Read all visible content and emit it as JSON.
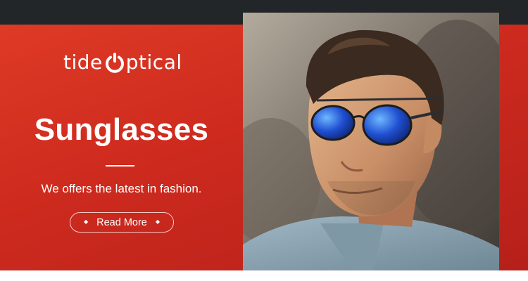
{
  "brand": {
    "prefix": "tide",
    "suffix": "ptical"
  },
  "hero": {
    "title": "Sunglasses",
    "tagline": "We offers the latest in fashion.",
    "cta_label": "Read More",
    "cta_left_icon": "diamond-bullet-icon",
    "cta_right_icon": "diamond-bullet-icon"
  },
  "colors": {
    "top_bar": "#222629",
    "accent_red": "#d3301f",
    "text": "#ffffff"
  },
  "photo": {
    "icon": "model-in-aviator-sunglasses-photo"
  }
}
